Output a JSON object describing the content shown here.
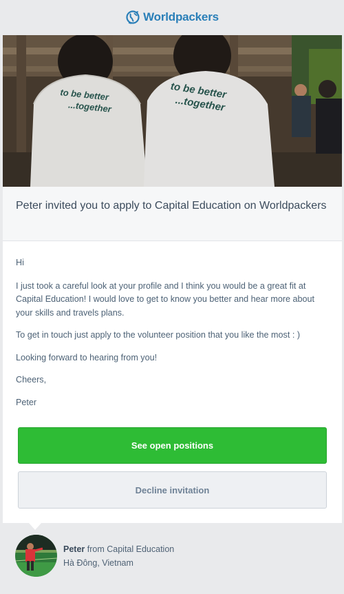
{
  "header": {
    "logo_icon": "globe-logo-icon",
    "brand": "Worldpackers",
    "brand_color": "#2a7fb8"
  },
  "hero": {
    "description_icon": "hero-photo",
    "shirt_text_line1": "to be better",
    "shirt_text_line2": "...together"
  },
  "invite": {
    "title": "Peter invited you to apply to Capital Education on Worldpackers"
  },
  "message": {
    "greeting": "Hi",
    "paragraph1": "I just took a careful look at your profile and I think you would be a great fit at Capital Education! I would love to get to know you better and hear more about your skills and travels plans.",
    "paragraph2": "To get in touch just apply to the volunteer position that you like the most : )",
    "paragraph3": "Looking forward to hearing from you!",
    "closing": "Cheers,",
    "signature": "Peter"
  },
  "actions": {
    "primary_label": "See open positions",
    "primary_color": "#2ebc35",
    "secondary_label": "Decline invitation"
  },
  "sender": {
    "name": "Peter",
    "from_text": "from Capital Education",
    "location": "Hà Đông, Vietnam",
    "avatar_icon": "avatar"
  }
}
